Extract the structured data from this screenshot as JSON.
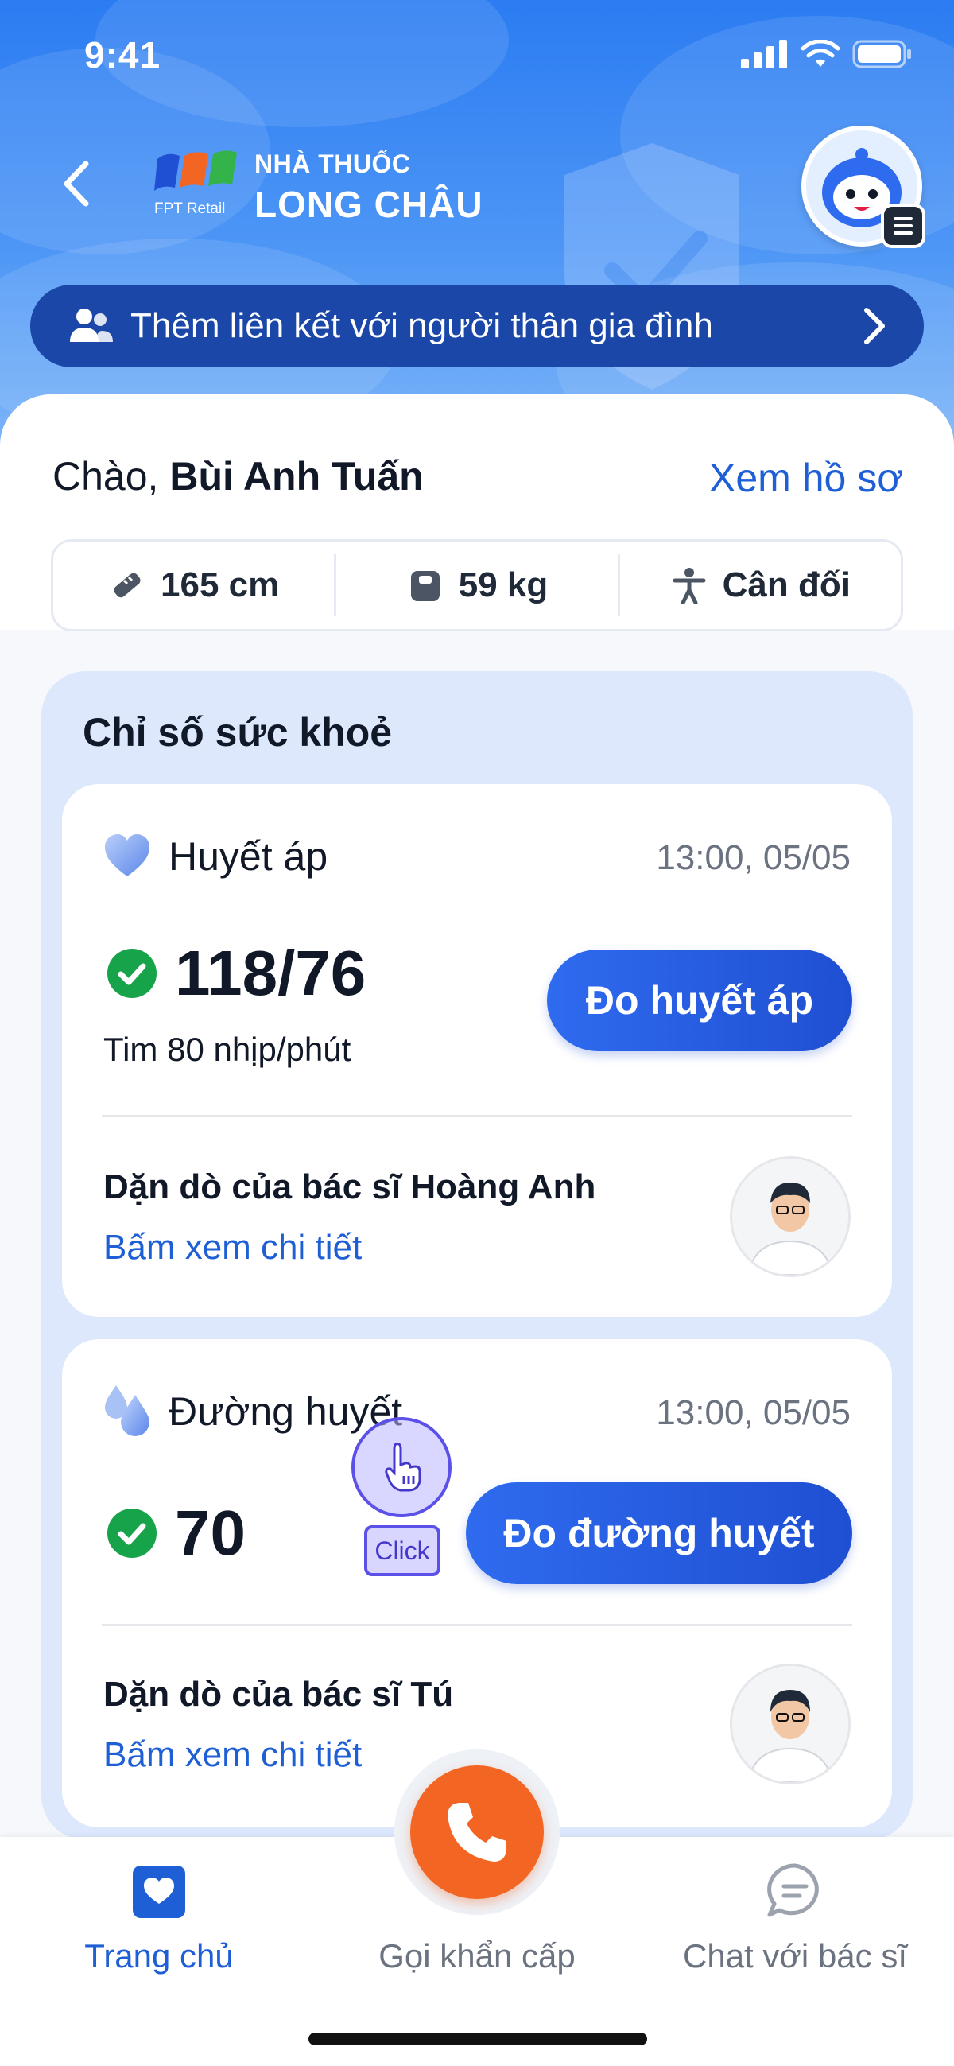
{
  "status_bar": {
    "time": "9:41"
  },
  "header": {
    "logo_top": "NHÀ THUỐC",
    "logo_main": "LONG CHÂU",
    "logo_sub": "FPT Retail",
    "family_link": "Thêm liên kết với người thân gia đình"
  },
  "profile": {
    "greeting": "Chào,",
    "name": "Bùi Anh Tuấn",
    "view_profile": "Xem hồ sơ",
    "height": "165 cm",
    "weight": "59 kg",
    "body_status": "Cân đối"
  },
  "health": {
    "section_title": "Chỉ số sức khoẻ",
    "blood_pressure": {
      "title": "Huyết áp",
      "time": "13:00, 05/05",
      "value": "118/76",
      "heart_rate": "Tim 80 nhịp/phút",
      "button": "Đo huyết áp",
      "advice": "Dặn dò của bác sĩ Hoàng Anh",
      "advice_link": "Bấm xem chi tiết"
    },
    "blood_sugar": {
      "title": "Đường huyết",
      "time": "13:00, 05/05",
      "value": "70",
      "button": "Đo đường huyết",
      "advice": "Dặn dò của bác sĩ Tú",
      "advice_link": "Bấm xem chi tiết"
    }
  },
  "cursor": {
    "label": "Click"
  },
  "bottom_nav": {
    "items": [
      {
        "label": "Trang chủ",
        "icon": "heart-home-icon",
        "active": true
      },
      {
        "label": "Gọi khẩn cấp",
        "icon": "phone-icon",
        "active": false
      },
      {
        "label": "Chat với bác sĩ",
        "icon": "chat-icon",
        "active": false
      }
    ]
  },
  "colors": {
    "accent": "#1f5fd6",
    "header_bar": "#1a47a8",
    "emergency": "#f26522",
    "ok": "#16a34a",
    "panel": "#dde8fd"
  }
}
